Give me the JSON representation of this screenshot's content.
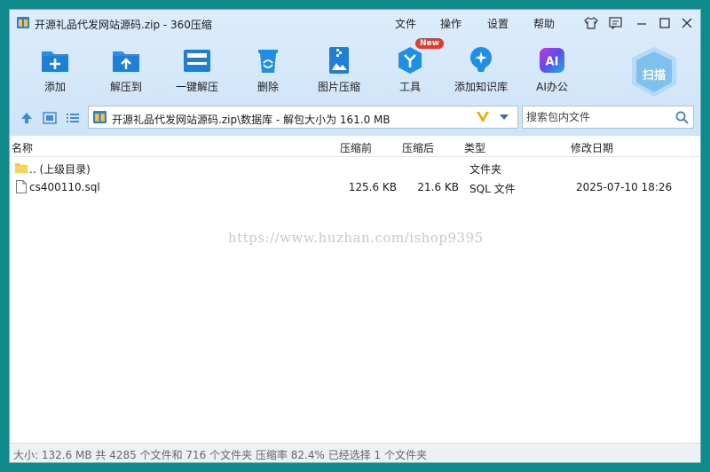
{
  "window": {
    "title": "开源礼品代发网站源码.zip - 360压缩"
  },
  "menu": [
    "文件",
    "操作",
    "设置",
    "帮助"
  ],
  "toolbar": [
    {
      "label": "添加",
      "icon": "add-icon"
    },
    {
      "label": "解压到",
      "icon": "extract-to-icon"
    },
    {
      "label": "一键解压",
      "icon": "one-click-extract-icon"
    },
    {
      "label": "删除",
      "icon": "delete-icon"
    },
    {
      "label": "图片压缩",
      "icon": "image-compress-icon"
    },
    {
      "label": "工具",
      "icon": "tools-icon",
      "badge": "New"
    },
    {
      "label": "添加知识库",
      "icon": "knowledge-base-icon"
    },
    {
      "label": "AI办公",
      "icon": "ai-office-icon",
      "icon_text": "AI"
    }
  ],
  "scan": {
    "label": "扫描"
  },
  "address": {
    "path": "开源礼品代发网站源码.zip\\数据库 - 解包大小为 161.0 MB"
  },
  "search": {
    "placeholder": "搜索包内文件"
  },
  "columns": [
    "名称",
    "压缩前",
    "压缩后",
    "类型",
    "修改日期"
  ],
  "files": [
    {
      "name": ".. (上级目录)",
      "original": "",
      "compressed": "",
      "type": "文件夹",
      "modified": "",
      "icon": "folder-icon"
    },
    {
      "name": "cs400110.sql",
      "original": "125.6 KB",
      "compressed": "21.6 KB",
      "type": "SQL 文件",
      "modified": "2025-07-10 18:26",
      "icon": "file-icon"
    }
  ],
  "watermark": "https://www.huzhan.com/ishop9395",
  "status": "大小: 132.6 MB 共 4285 个文件和 716 个文件夹 压缩率 82.4% 已经选择 1 个文件夹",
  "colors": {
    "accent": "#1e8be0",
    "background": "#0e8a8a",
    "chrome": "#d6e8fa"
  }
}
